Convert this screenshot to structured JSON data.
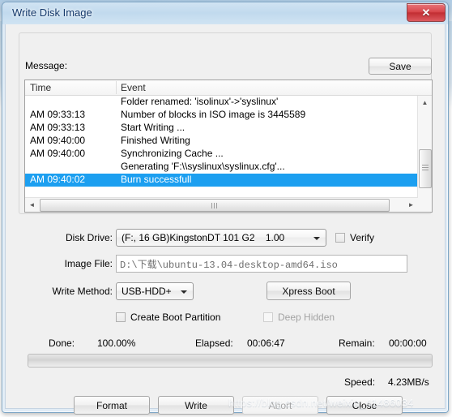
{
  "window": {
    "title": "Write Disk Image",
    "close_label": "✕"
  },
  "message_group": {
    "label": "Message:",
    "save_label": "Save",
    "columns": [
      "Time",
      "Event"
    ],
    "rows": [
      {
        "time": "",
        "event": "Folder renamed: 'isolinux'->'syslinux'",
        "selected": false
      },
      {
        "time": "AM 09:33:13",
        "event": "Number of blocks in ISO image is 3445589",
        "selected": false
      },
      {
        "time": "AM 09:33:13",
        "event": "Start Writing ...",
        "selected": false
      },
      {
        "time": "AM 09:40:00",
        "event": "Finished Writing",
        "selected": false
      },
      {
        "time": "AM 09:40:00",
        "event": "Synchronizing Cache ...",
        "selected": false
      },
      {
        "time": "",
        "event": "Generating 'F:\\\\syslinux\\syslinux.cfg'...",
        "selected": false
      },
      {
        "time": "AM 09:40:02",
        "event": "Burn successfull",
        "selected": true
      }
    ],
    "scroll_up_icon": "▲",
    "scroll_down_icon": "▼",
    "scroll_left_icon": "◄",
    "scroll_right_icon": "►"
  },
  "form": {
    "disk_drive_label": "Disk Drive:",
    "disk_drive_value": "(F:, 16 GB)KingstonDT 101 G2    1.00",
    "verify_label": "Verify",
    "image_file_label": "Image File:",
    "image_file_value": "D:\\下载\\ubuntu-13.04-desktop-amd64.iso",
    "write_method_label": "Write Method:",
    "write_method_value": "USB-HDD+",
    "xpress_boot_label": "Xpress Boot",
    "create_boot_partition_label": "Create Boot Partition",
    "deep_hidden_label": "Deep Hidden"
  },
  "status": {
    "done_label": "Done:",
    "done_value": "100.00%",
    "elapsed_label": "Elapsed:",
    "elapsed_value": "00:06:47",
    "remain_label": "Remain:",
    "remain_value": "00:00:00",
    "speed_label": "Speed:",
    "speed_value": "4.23MB/s",
    "progress_percent": 100
  },
  "buttons": {
    "format": "Format",
    "write": "Write",
    "abort": "Abort",
    "close": "Close"
  },
  "watermark": "https://blog.csdn.net/weixin_41486034",
  "colors": {
    "selection": "#1c9ff0",
    "close_button": "#d9484d",
    "title_text": "#15396b"
  }
}
